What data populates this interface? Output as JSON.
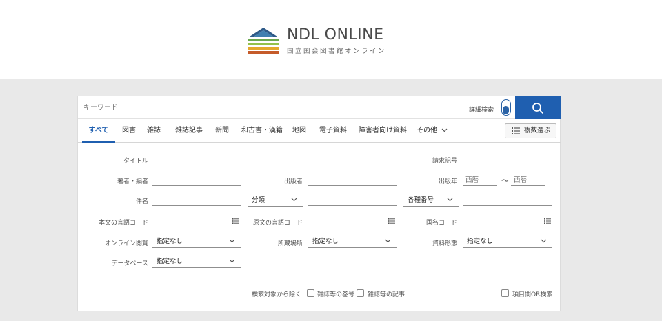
{
  "logo": {
    "title": "NDL ONLINE",
    "subtitle": "国立国会図書館オンライン"
  },
  "search": {
    "keyword_placeholder": "キーワード",
    "advanced_label": "詳細検索",
    "advanced_toggle_on": true,
    "search_icon": "search-icon"
  },
  "tabs": [
    {
      "label": "すべて",
      "active": true
    },
    {
      "label": "図書"
    },
    {
      "label": "雑誌"
    },
    {
      "label": "雑誌記事"
    },
    {
      "label": "新聞"
    },
    {
      "label": "和古書・漢籍"
    },
    {
      "label": "地図"
    },
    {
      "label": "電子資料"
    },
    {
      "label": "障害者向け資料"
    },
    {
      "label": "その他"
    }
  ],
  "multi_select": {
    "label": "複数選ぶ",
    "icon": "list-icon"
  },
  "fields": {
    "title": "タイトル",
    "call_number": "請求記号",
    "author": "著者・編者",
    "publisher": "出版者",
    "pub_year": "出版年",
    "pub_year_from": "西暦",
    "pub_year_to": "西暦",
    "tilde": "～",
    "subject": "件名",
    "classification": "分類",
    "number_type": "各種番号",
    "text_lang": "本文の言語コード",
    "orig_lang": "原文の言語コード",
    "country": "国名コード",
    "online_view": "オンライン閲覧",
    "online_view_value": "指定なし",
    "location": "所蔵場所",
    "location_value": "指定なし",
    "material_form": "資料形態",
    "material_form_value": "指定なし",
    "database": "データベース",
    "database_value": "指定なし"
  },
  "exclude": {
    "label": "検索対象から除く",
    "opt1": "雑誌等の巻号",
    "opt2": "雑誌等の記事",
    "or_search": "項目間OR検索"
  },
  "colors": {
    "accent": "#1f5fb0",
    "background": "#e9e9e9"
  }
}
